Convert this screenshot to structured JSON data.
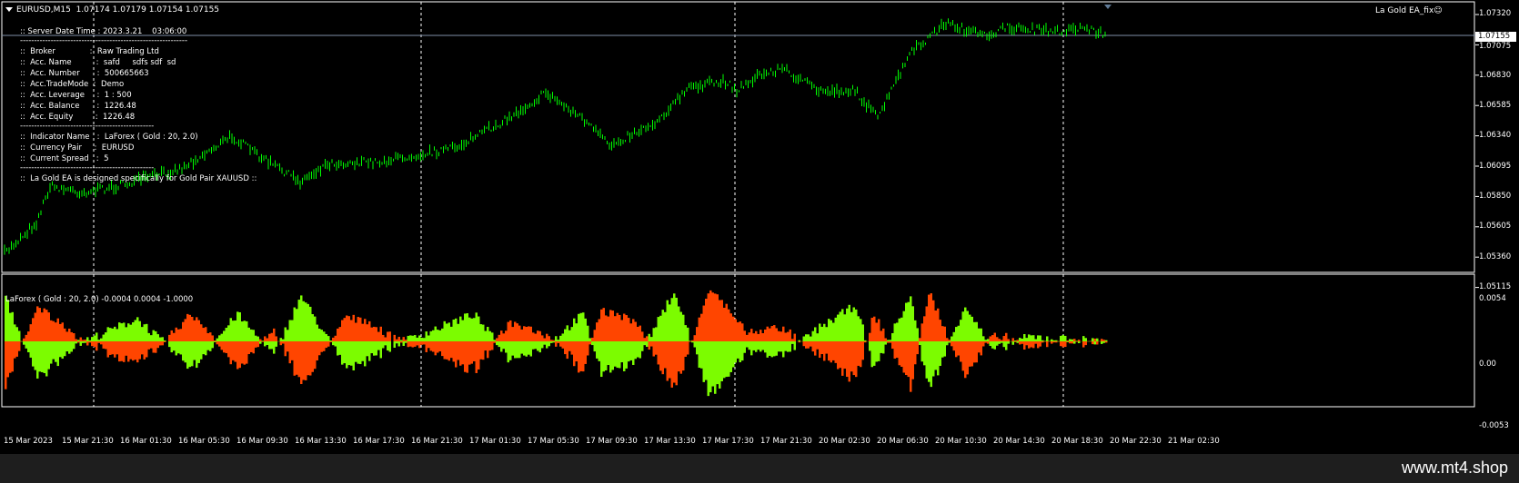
{
  "header": {
    "symbol_tf": "EURUSD,M15",
    "ohlc": "1.07174 1.07179 1.07154 1.07155"
  },
  "ea": {
    "label": "La Gold EA_fix",
    "face": "☺"
  },
  "info": {
    "server_time": ":: Server Date Time : 2023.3.21    03:06:00",
    "sep": "------------------------------------------------------------",
    "sep_short": "------------------------------------------------",
    "broker": "::  Broker              :  Raw Trading Ltd",
    "acc_name": "::  Acc. Name          :  safd     sdfs sdf  sd",
    "acc_number": "::  Acc. Number       :  500665663",
    "acc_mode": "::  Acc.TradeMode  :  Demo",
    "acc_leverage": "::  Acc. Leverage     :  1 : 500",
    "acc_balance": "::  Acc. Balance       :  1226.48",
    "acc_equity": "::  Acc. Equity         :  1226.48",
    "indicator": "::  Indicator Name   :  LaForex ( Gold : 20, 2.0)",
    "pair": "::  Currency Pair     :  EURUSD",
    "spread": "::  Current Spread   :  5",
    "note": "::  La Gold EA is designed specifically for Gold Pair XAUUSD ::"
  },
  "price_axis": [
    "1.07320",
    "1.07075",
    "1.06830",
    "1.06585",
    "1.06340",
    "1.06095",
    "1.05850",
    "1.05605",
    "1.05360",
    "1.05115"
  ],
  "current_price": "1.07155",
  "indicator": {
    "title": "LaForex ( Gold : 20, 2.0) -0.0004 0.0004 -1.0000",
    "axis": [
      "0.0054",
      "0.00",
      "-0.0053"
    ]
  },
  "time_axis": [
    "15 Mar 2023",
    "15 Mar 21:30",
    "16 Mar 01:30",
    "16 Mar 05:30",
    "16 Mar 09:30",
    "16 Mar 13:30",
    "16 Mar 17:30",
    "16 Mar 21:30",
    "17 Mar 01:30",
    "17 Mar 05:30",
    "17 Mar 09:30",
    "17 Mar 13:30",
    "17 Mar 17:30",
    "17 Mar 21:30",
    "20 Mar 02:30",
    "20 Mar 06:30",
    "20 Mar 10:30",
    "20 Mar 14:30",
    "20 Mar 18:30",
    "20 Mar 22:30",
    "21 Mar 02:30"
  ],
  "footer": {
    "site": "www.mt4.shop"
  },
  "colors": {
    "bull": "#00ff00",
    "up_hist": "#7cfc00",
    "down_hist": "#ff4500",
    "bg": "#000000"
  }
}
